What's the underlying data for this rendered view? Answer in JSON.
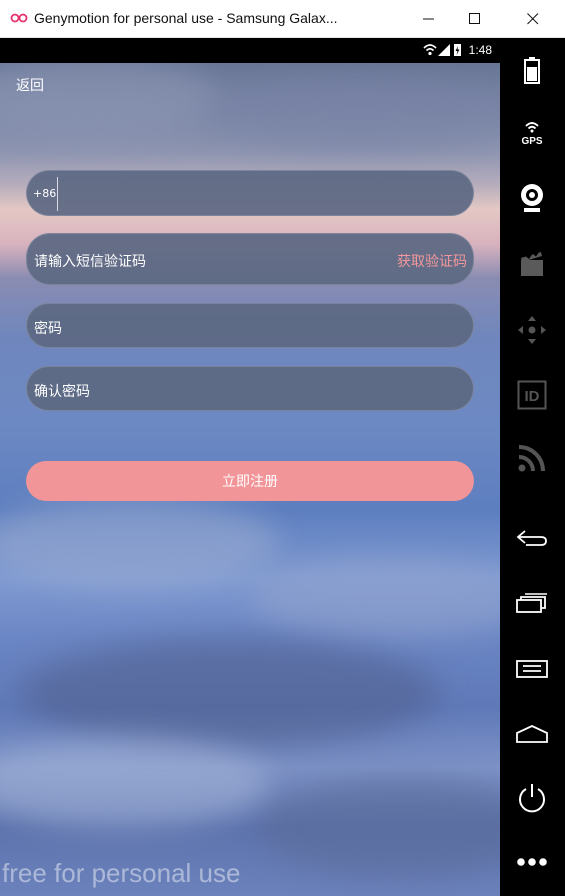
{
  "window": {
    "title": "Genymotion for personal use - Samsung Galax...",
    "logo_icon": "genymotion-logo-icon",
    "controls": [
      "minimize-icon",
      "maximize-icon",
      "close-icon"
    ]
  },
  "device": {
    "status_bar": {
      "time": "1:48",
      "icons": [
        "wifi-icon",
        "signal-icon",
        "battery-charging-icon"
      ]
    }
  },
  "app": {
    "back_label": "返回",
    "phone": {
      "prefix": "+86",
      "value": "",
      "placeholder": ""
    },
    "sms_code": {
      "placeholder": "请输入短信验证码",
      "get_code_label": "获取验证码",
      "get_code_color": "#f2979b"
    },
    "password": {
      "placeholder": "密码"
    },
    "confirm_password": {
      "placeholder": "确认密码"
    },
    "register_label": "立即注册",
    "register_color": "#f29598"
  },
  "watermark": "free for personal use",
  "sidebar": {
    "items": [
      {
        "name": "battery-icon"
      },
      {
        "name": "gps-icon",
        "label": "GPS"
      },
      {
        "name": "webcam-icon"
      },
      {
        "name": "screencast-icon"
      },
      {
        "name": "dpad-icon"
      },
      {
        "name": "device-id-icon",
        "label": "ID"
      },
      {
        "name": "broadcast-icon"
      },
      {
        "name": "back-icon"
      },
      {
        "name": "recent-apps-icon"
      },
      {
        "name": "menu-icon"
      },
      {
        "name": "home-icon"
      },
      {
        "name": "power-icon"
      },
      {
        "name": "more-icon"
      }
    ]
  }
}
